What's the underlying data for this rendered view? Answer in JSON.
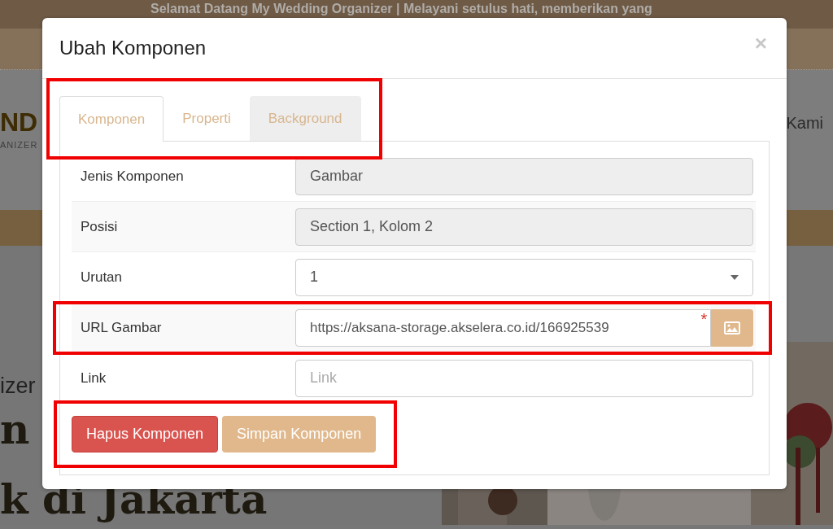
{
  "background_page": {
    "marquee": "Selamat Datang My Wedding Organizer | Melayani setulus hati, memberikan yang",
    "logo_text": "ND",
    "logo_tagline": "ANIZER",
    "nav_item": "Kami",
    "hero_subtitle": "izer",
    "hero_heading_lines": [
      "n",
      "k di Jakarta"
    ]
  },
  "modal": {
    "title": "Ubah Komponen",
    "close": "×",
    "tabs": {
      "highlighted": true,
      "items": [
        {
          "label": "Komponen",
          "selected": true,
          "hovered": false
        },
        {
          "label": "Properti",
          "selected": false,
          "hovered": false
        },
        {
          "label": "Background",
          "selected": false,
          "hovered": true
        }
      ]
    },
    "fields": [
      {
        "label": "Jenis Komponen",
        "kind": "readonly",
        "value": "Gambar",
        "highlighted": false
      },
      {
        "label": "Posisi",
        "kind": "readonly",
        "value": "Section 1, Kolom 2",
        "highlighted": false
      },
      {
        "label": "Urutan",
        "kind": "select",
        "value": "1",
        "highlighted": false
      },
      {
        "label": "URL Gambar",
        "kind": "image-url",
        "value": "https://aksana-storage.akselera.co.id/166925539",
        "required_mark": "*",
        "highlighted": true
      },
      {
        "label": "Link",
        "kind": "input",
        "placeholder": "Link",
        "highlighted": false
      }
    ],
    "actions": {
      "highlighted": true,
      "buttons": [
        {
          "label": "Hapus Komponen",
          "kind": "danger"
        },
        {
          "label": "Simpan Komponen",
          "kind": "primary"
        }
      ]
    }
  }
}
